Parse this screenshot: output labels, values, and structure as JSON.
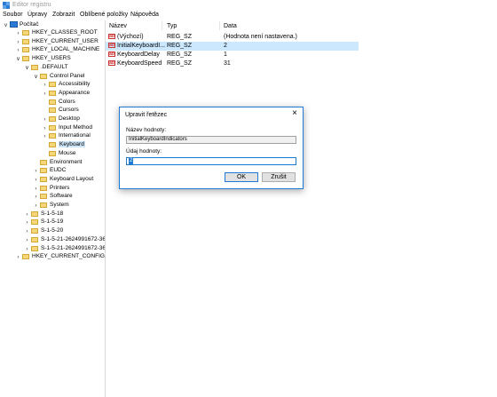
{
  "window": {
    "title": "Editor registru"
  },
  "menu": [
    {
      "label": "Soubor"
    },
    {
      "label": "Úpravy"
    },
    {
      "label": "Zobrazit"
    },
    {
      "label": "Oblíbené položky"
    },
    {
      "label": "Nápověda"
    }
  ],
  "tree": {
    "root": "Počítač",
    "items": [
      {
        "label": "HKEY_CLASSES_ROOT",
        "depth": 1,
        "exp": ">"
      },
      {
        "label": "HKEY_CURRENT_USER",
        "depth": 1,
        "exp": ">"
      },
      {
        "label": "HKEY_LOCAL_MACHINE",
        "depth": 1,
        "exp": ">"
      },
      {
        "label": "HKEY_USERS",
        "depth": 1,
        "exp": "v"
      },
      {
        "label": ".DEFAULT",
        "depth": 2,
        "exp": "v"
      },
      {
        "label": "Control Panel",
        "depth": 3,
        "exp": "v"
      },
      {
        "label": "Accessibility",
        "depth": 4,
        "exp": ">"
      },
      {
        "label": "Appearance",
        "depth": 4,
        "exp": ">"
      },
      {
        "label": "Colors",
        "depth": 4,
        "exp": ""
      },
      {
        "label": "Cursors",
        "depth": 4,
        "exp": ""
      },
      {
        "label": "Desktop",
        "depth": 4,
        "exp": ">"
      },
      {
        "label": "Input Method",
        "depth": 4,
        "exp": ">"
      },
      {
        "label": "International",
        "depth": 4,
        "exp": ">"
      },
      {
        "label": "Keyboard",
        "depth": 4,
        "exp": "",
        "selected": true
      },
      {
        "label": "Mouse",
        "depth": 4,
        "exp": ""
      },
      {
        "label": "Environment",
        "depth": 3,
        "exp": ""
      },
      {
        "label": "EUDC",
        "depth": 3,
        "exp": ">"
      },
      {
        "label": "Keyboard Layout",
        "depth": 3,
        "exp": ">"
      },
      {
        "label": "Printers",
        "depth": 3,
        "exp": ">"
      },
      {
        "label": "Software",
        "depth": 3,
        "exp": ">"
      },
      {
        "label": "System",
        "depth": 3,
        "exp": ">"
      },
      {
        "label": "S-1-5-18",
        "depth": 2,
        "exp": ">"
      },
      {
        "label": "S-1-5-19",
        "depth": 2,
        "exp": ">"
      },
      {
        "label": "S-1-5-20",
        "depth": 2,
        "exp": ">"
      },
      {
        "label": "S-1-5-21-2624991672-368",
        "depth": 2,
        "exp": ">"
      },
      {
        "label": "S-1-5-21-2624991672-368",
        "depth": 2,
        "exp": ">"
      },
      {
        "label": "HKEY_CURRENT_CONFIG",
        "depth": 1,
        "exp": ">"
      }
    ]
  },
  "list": {
    "headers": {
      "name": "Název",
      "type": "Typ",
      "data": "Data"
    },
    "rows": [
      {
        "name": "(Výchozí)",
        "type": "REG_SZ",
        "data": "(Hodnota není nastavena.)",
        "selected": false
      },
      {
        "name": "InitialKeyboardI...",
        "type": "REG_SZ",
        "data": "2",
        "selected": true
      },
      {
        "name": "KeyboardDelay",
        "type": "REG_SZ",
        "data": "1",
        "selected": false
      },
      {
        "name": "KeyboardSpeed",
        "type": "REG_SZ",
        "data": "31",
        "selected": false
      }
    ],
    "value_icon": "ab-string-icon"
  },
  "dialog": {
    "title": "Upravit řetězec",
    "value_name_label": "Název hodnoty:",
    "value_name": "InitialKeyboardIndicators",
    "value_data_label": "Údaj hodnoty:",
    "value_data": "2",
    "ok": "OK",
    "cancel": "Zrušit"
  }
}
